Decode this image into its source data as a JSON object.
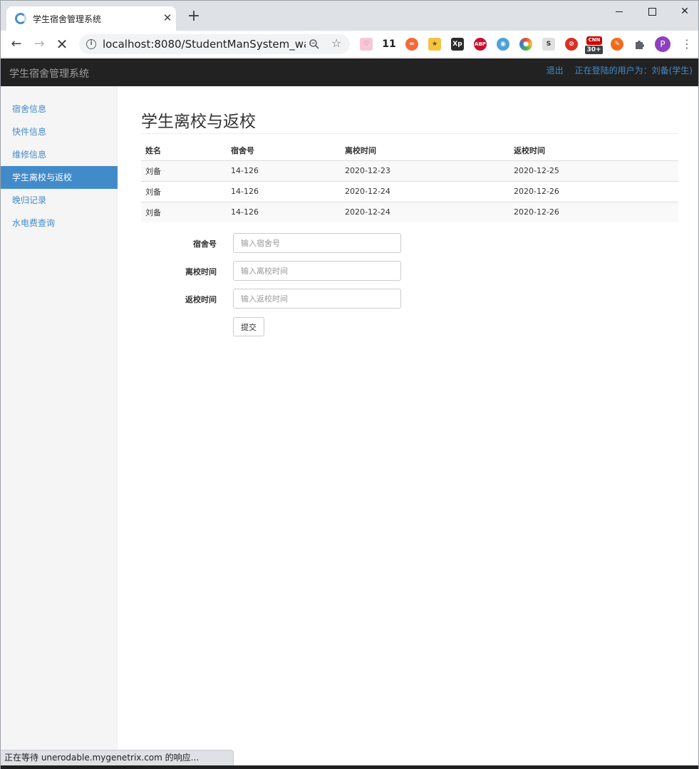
{
  "browser": {
    "tab_title": "学生宿舍管理系统",
    "tab_close": "✕",
    "new_tab": "+",
    "url": "localhost:8080/StudentManSystem_war...",
    "profile_initial": "P",
    "extension_badge_count": "11",
    "extension_badge_count2": "30+",
    "status_text": "正在等待 unerodable.mygenetrix.com 的响应..."
  },
  "navbar": {
    "brand": "学生宿舍管理系统",
    "logout": "退出",
    "current_user": "正在登陆的用户为：刘备(学生)"
  },
  "sidebar": {
    "items": [
      {
        "label": "宿舍信息"
      },
      {
        "label": "快件信息"
      },
      {
        "label": "维修信息"
      },
      {
        "label": "学生离校与返校"
      },
      {
        "label": "晚归记录"
      },
      {
        "label": "水电费查询"
      }
    ],
    "active_index": 3
  },
  "main": {
    "title": "学生离校与返校",
    "table": {
      "headers": [
        "姓名",
        "宿舍号",
        "离校时间",
        "返校时间"
      ],
      "rows": [
        [
          "刘备",
          "14-126",
          "2020-12-23",
          "2020-12-25"
        ],
        [
          "刘备",
          "14-126",
          "2020-12-24",
          "2020-12-26"
        ],
        [
          "刘备",
          "14-126",
          "2020-12-24",
          "2020-12-26"
        ]
      ]
    },
    "form": {
      "dorm_label": "宿舍号",
      "dorm_placeholder": "输入宿舍号",
      "leave_label": "离校时间",
      "leave_placeholder": "输入离校时间",
      "return_label": "返校时间",
      "return_placeholder": "输入返校时间",
      "submit": "提交"
    }
  },
  "colors": {
    "navbar_bg": "#222222",
    "link": "#428bca",
    "sidebar_bg": "#f5f5f5"
  }
}
